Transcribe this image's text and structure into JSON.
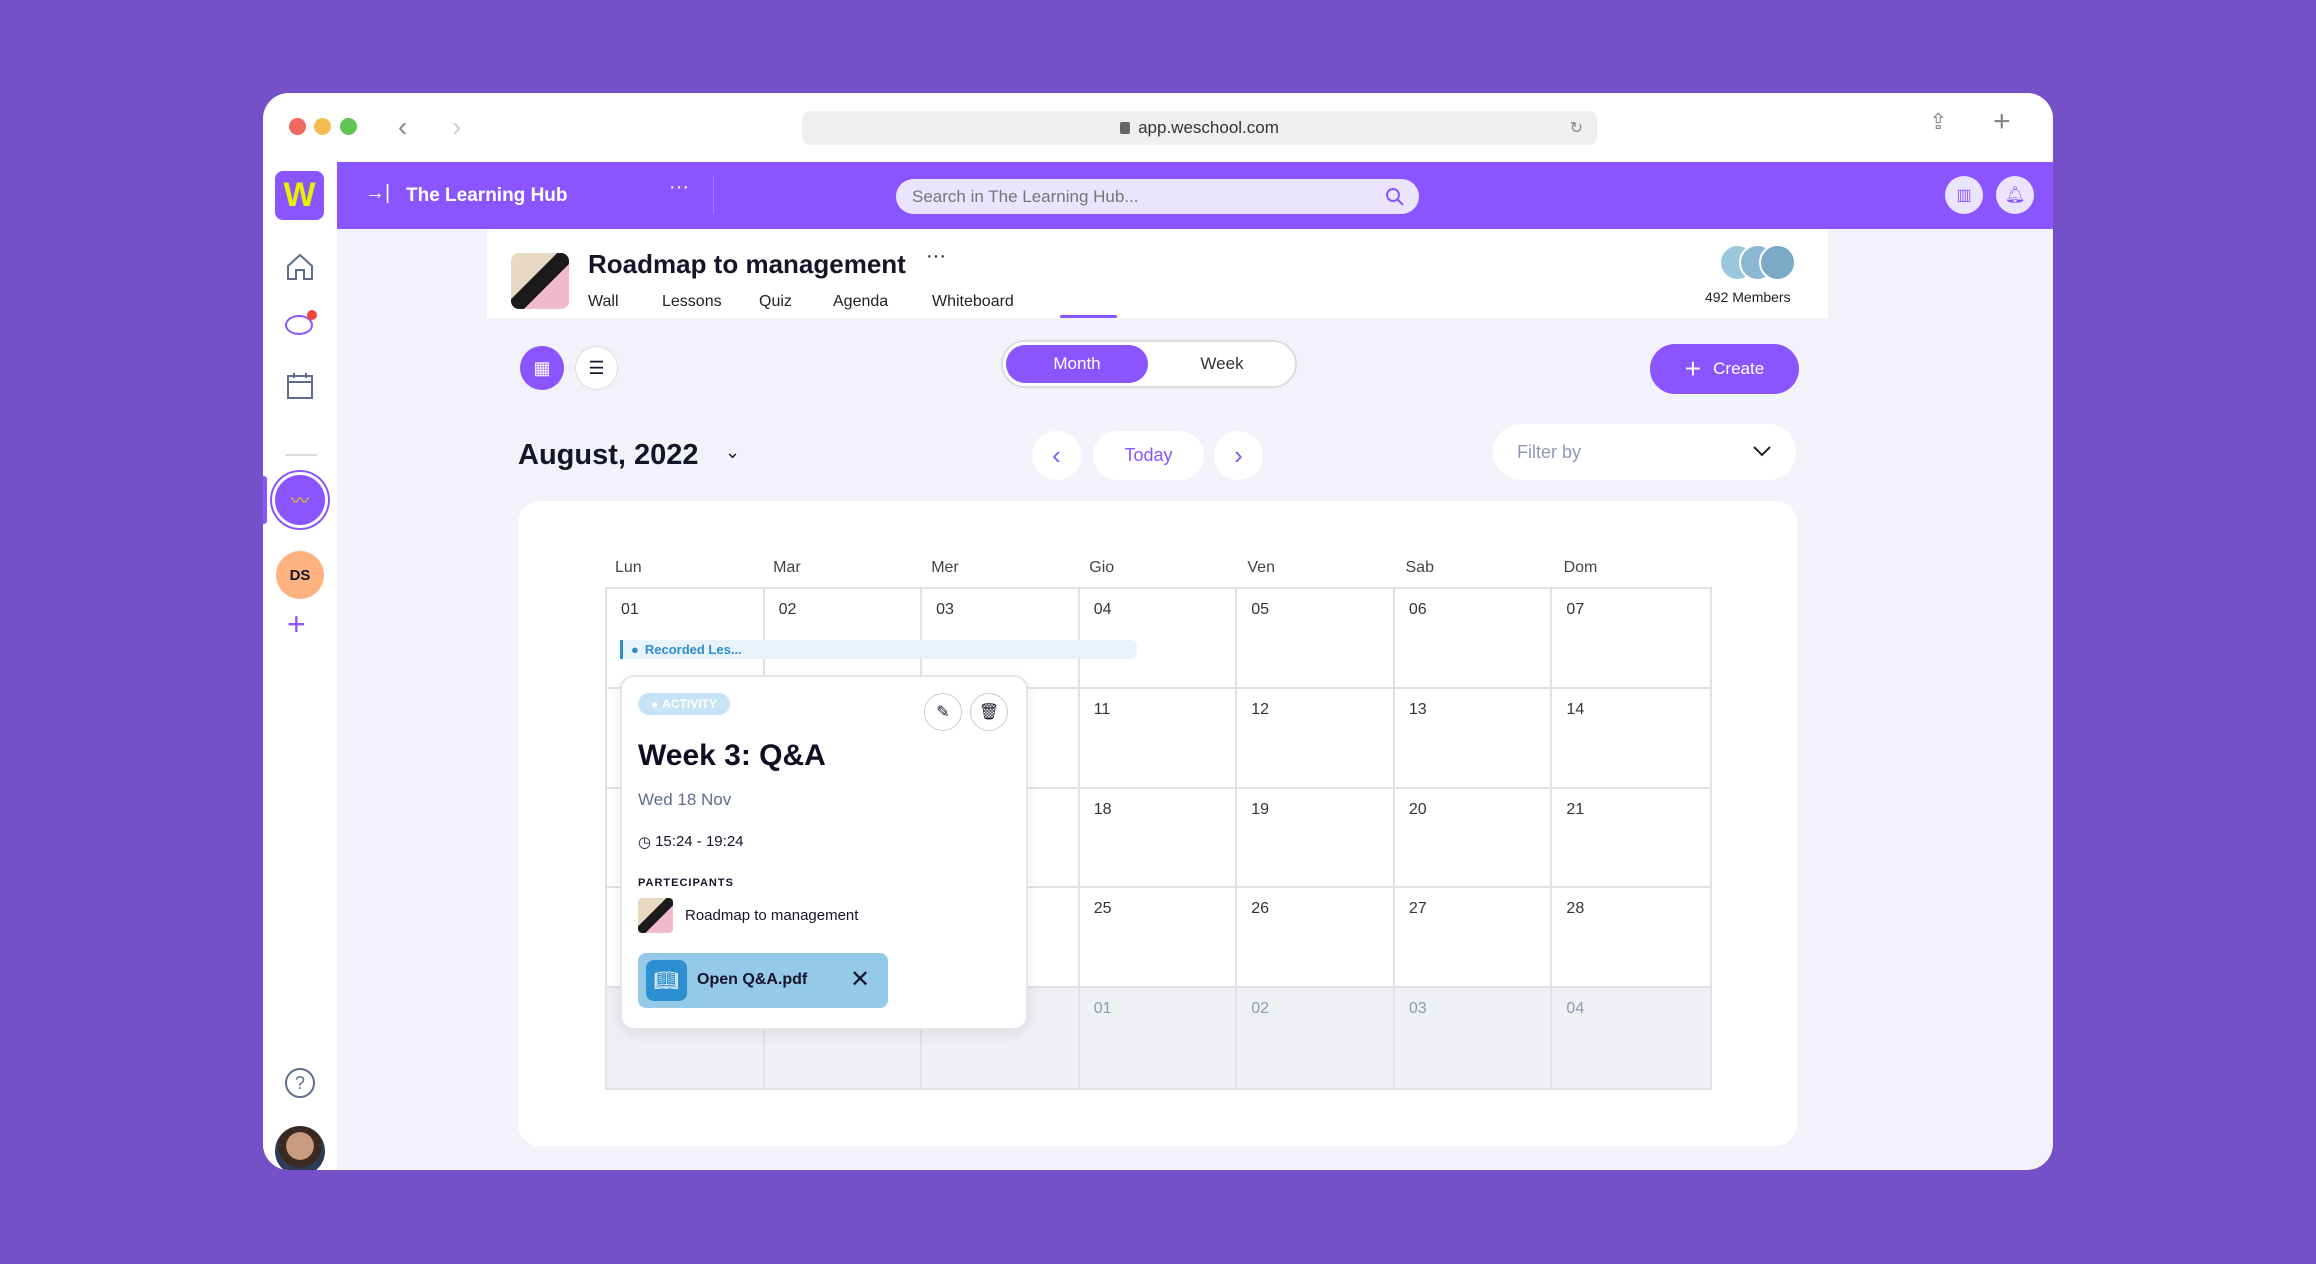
{
  "browser": {
    "url": "app.weschool.com"
  },
  "colors": {
    "brand": "#8a55fe",
    "outer": "#7650c8",
    "event": "#2c8fcf"
  },
  "header": {
    "space_name": "The Learning Hub",
    "search_placeholder": "Search in The Learning Hub..."
  },
  "sidebar": {
    "logo": "W",
    "group_initials": "DS"
  },
  "course": {
    "title": "Roadmap to management",
    "tabs": [
      "Wall",
      "Lessons",
      "Quiz",
      "Agenda",
      "Whiteboard"
    ],
    "active_tab": "Agenda",
    "members": "492 Members"
  },
  "toolbar": {
    "views": [
      "Month",
      "Week"
    ],
    "active_view": "Month",
    "create": "Create"
  },
  "calendar": {
    "month_label": "August, 2022",
    "today": "Today",
    "filter_placeholder": "Filter by",
    "weekdays": [
      "Lun",
      "Mar",
      "Mer",
      "Gio",
      "Ven",
      "Sab",
      "Dom"
    ],
    "weeks": [
      [
        "01",
        "02",
        "03",
        "04",
        "05",
        "06",
        "07"
      ],
      [
        "",
        "",
        "",
        "11",
        "12",
        "13",
        "14"
      ],
      [
        "",
        "",
        "",
        "18",
        "19",
        "20",
        "21"
      ],
      [
        "",
        "",
        "",
        "25",
        "26",
        "27",
        "28"
      ],
      [
        "",
        "",
        "",
        "01",
        "02",
        "03",
        "04"
      ]
    ],
    "event_bar": "Recorded Les..."
  },
  "popup": {
    "badge": "ACTIVITY",
    "title": "Week 3: Q&A",
    "date": "Wed 18 Nov",
    "time": "15:24 - 19:24",
    "participants_label": "PARTECIPANTS",
    "participant": "Roadmap to management",
    "attachment": "Open Q&A.pdf"
  }
}
